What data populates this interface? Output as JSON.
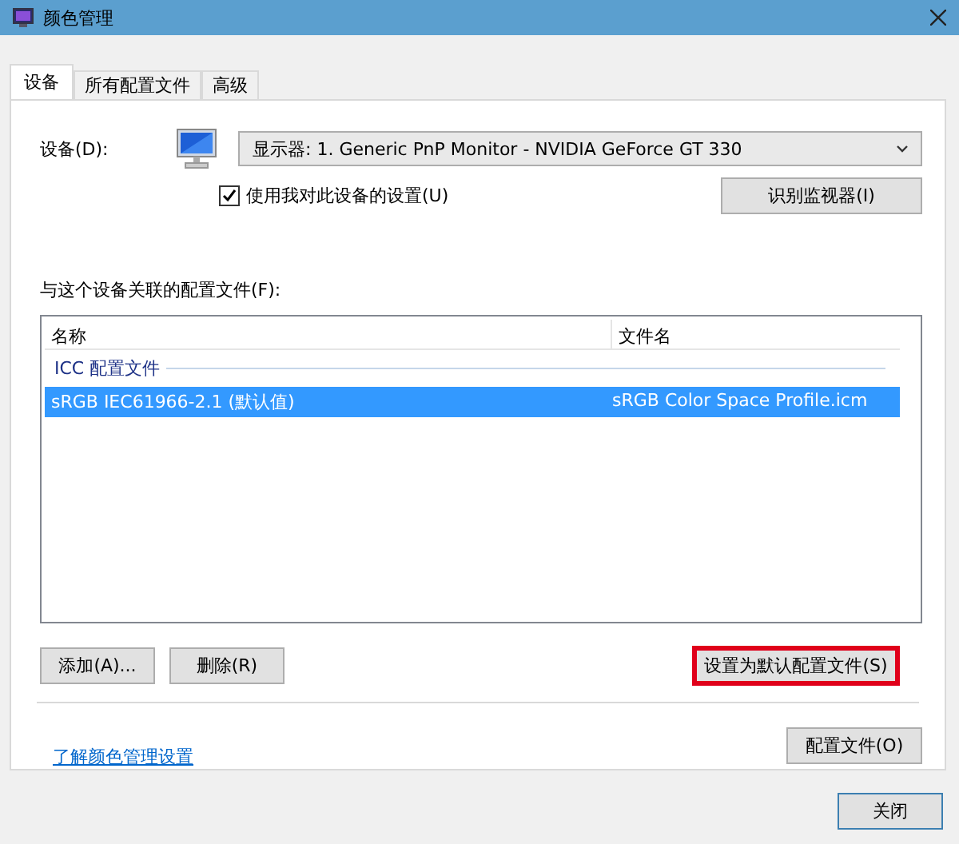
{
  "window": {
    "title": "颜色管理"
  },
  "tabs": [
    {
      "label": "设备",
      "selected": true
    },
    {
      "label": "所有配置文件",
      "selected": false
    },
    {
      "label": "高级",
      "selected": false
    }
  ],
  "device": {
    "label": "设备(D):",
    "value": "显示器: 1. Generic PnP Monitor - NVIDIA GeForce GT 330"
  },
  "use_my_settings": {
    "label": "使用我对此设备的设置(U)",
    "checked": true
  },
  "identify_button": "识别监视器(I)",
  "profiles_label": "与这个设备关联的配置文件(F):",
  "table": {
    "columns": [
      "名称",
      "文件名"
    ],
    "groups": [
      {
        "name": "ICC 配置文件",
        "rows": [
          {
            "name": "sRGB IEC61966-2.1 (默认值)",
            "file": "sRGB Color Space Profile.icm",
            "selected": true
          }
        ]
      }
    ]
  },
  "buttons": [
    {
      "label": "添加(A)...",
      "highlighted": false
    },
    {
      "label": "删除(R)",
      "highlighted": false
    },
    {
      "label": "设置为默认配置文件(S)",
      "highlighted": true
    }
  ],
  "link": "了解颜色管理设置",
  "profiles_button": "配置文件(O)",
  "close_button": "关闭"
}
